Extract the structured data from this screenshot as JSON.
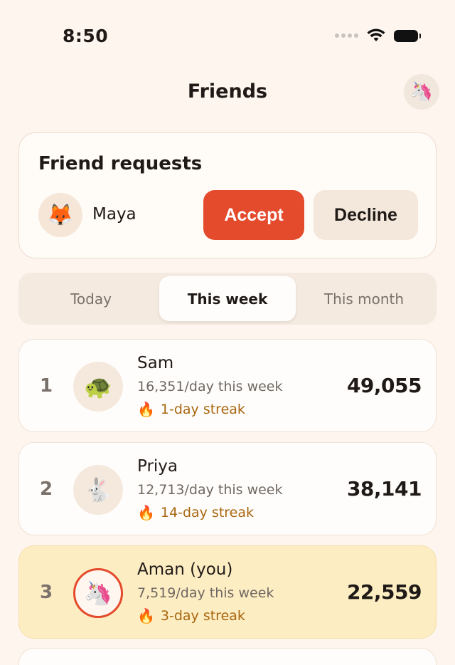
{
  "status": {
    "time": "8:50"
  },
  "header": {
    "title": "Friends",
    "profile_avatar": "🦄"
  },
  "requests": {
    "title": "Friend requests",
    "item": {
      "name": "Maya",
      "avatar": "🦊"
    },
    "accept_label": "Accept",
    "decline_label": "Decline"
  },
  "tabs": [
    {
      "label": "Today",
      "active": false
    },
    {
      "label": "This week",
      "active": true
    },
    {
      "label": "This month",
      "active": false
    }
  ],
  "leaderboard": [
    {
      "rank": "1",
      "name": "Sam",
      "avatar": "🐢",
      "rate": "16,351/day this week",
      "streak": "1-day streak",
      "total": "49,055",
      "is_you": false
    },
    {
      "rank": "2",
      "name": "Priya",
      "avatar": "🐇",
      "rate": "12,713/day this week",
      "streak": "14-day streak",
      "total": "38,141",
      "is_you": false
    },
    {
      "rank": "3",
      "name": "Aman (you)",
      "avatar": "🦄",
      "rate": "7,519/day this week",
      "streak": "3-day streak",
      "total": "22,559",
      "is_you": true
    }
  ],
  "icons": {
    "streak": "🔥"
  },
  "colors": {
    "accent": "#e44a2c",
    "background": "#fdf5ee",
    "highlight": "#fdedc3",
    "streak_text": "#a8660e"
  }
}
